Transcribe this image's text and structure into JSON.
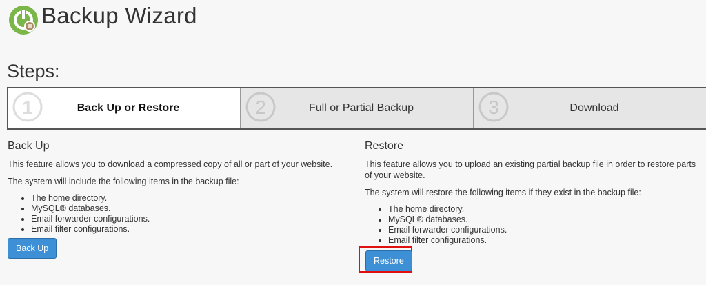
{
  "header": {
    "title": "Backup Wizard",
    "logo_icon": "backup-wizard-logo-icon"
  },
  "steps": {
    "title": "Steps:",
    "items": [
      {
        "number": "1",
        "label": "Back Up or Restore",
        "active": true
      },
      {
        "number": "2",
        "label": "Full or Partial Backup",
        "active": false
      },
      {
        "number": "3",
        "label": "Download",
        "active": false
      }
    ]
  },
  "backup": {
    "heading": "Back Up",
    "description": "This feature allows you to download a compressed copy of all or part of your website.",
    "intro": "The system will include the following items in the backup file:",
    "items": [
      "The home directory.",
      "MySQL® databases.",
      "Email forwarder configurations.",
      "Email filter configurations."
    ],
    "button_label": "Back Up"
  },
  "restore": {
    "heading": "Restore",
    "description": "This feature allows you to upload an existing partial backup file in order to restore parts of your website.",
    "intro": "The system will restore the following items if they exist in the backup file:",
    "items": [
      "The home directory.",
      "MySQL® databases.",
      "Email forwarder configurations.",
      "Email filter configurations."
    ],
    "button_label": "Restore"
  },
  "colors": {
    "accent": "#3d8fd6",
    "highlight_box": "#e01010",
    "logo_green": "#7ab648"
  }
}
